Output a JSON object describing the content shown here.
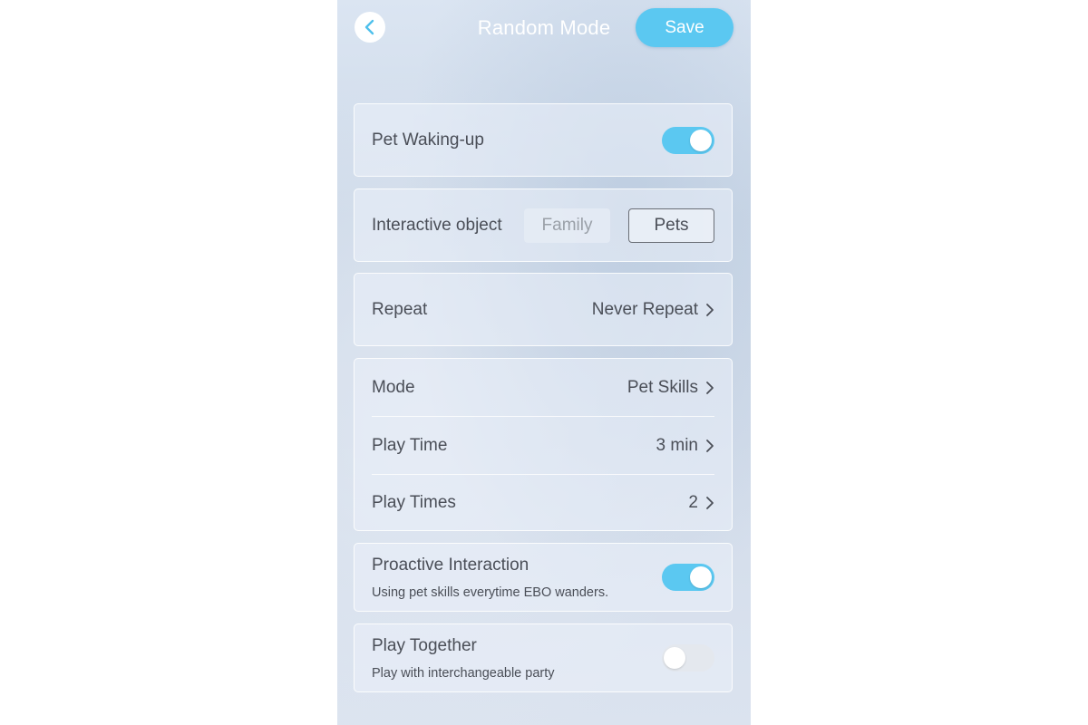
{
  "header": {
    "title": "Random Mode",
    "save_label": "Save"
  },
  "pet_waking_up": {
    "label": "Pet Waking-up",
    "enabled": true
  },
  "interactive_object": {
    "label": "Interactive object",
    "options": [
      "Family",
      "Pets"
    ],
    "selected": "Pets"
  },
  "repeat": {
    "label": "Repeat",
    "value": "Never Repeat"
  },
  "mode_group": {
    "mode": {
      "label": "Mode",
      "value": "Pet Skills"
    },
    "play_time": {
      "label": "Play Time",
      "value": "3 min"
    },
    "play_times": {
      "label": "Play Times",
      "value": "2"
    }
  },
  "proactive_interaction": {
    "label": "Proactive Interaction",
    "description": "Using pet skills everytime EBO wanders.",
    "enabled": true
  },
  "play_together": {
    "label": "Play Together",
    "description": "Play with interchangeable party",
    "enabled": false
  },
  "colors": {
    "accent": "#5bc8f1",
    "text": "#4a4e57",
    "muted_text": "#9aa0a8"
  },
  "icons": {
    "back": "chevron-left-icon",
    "disclosure": "chevron-right-icon"
  }
}
